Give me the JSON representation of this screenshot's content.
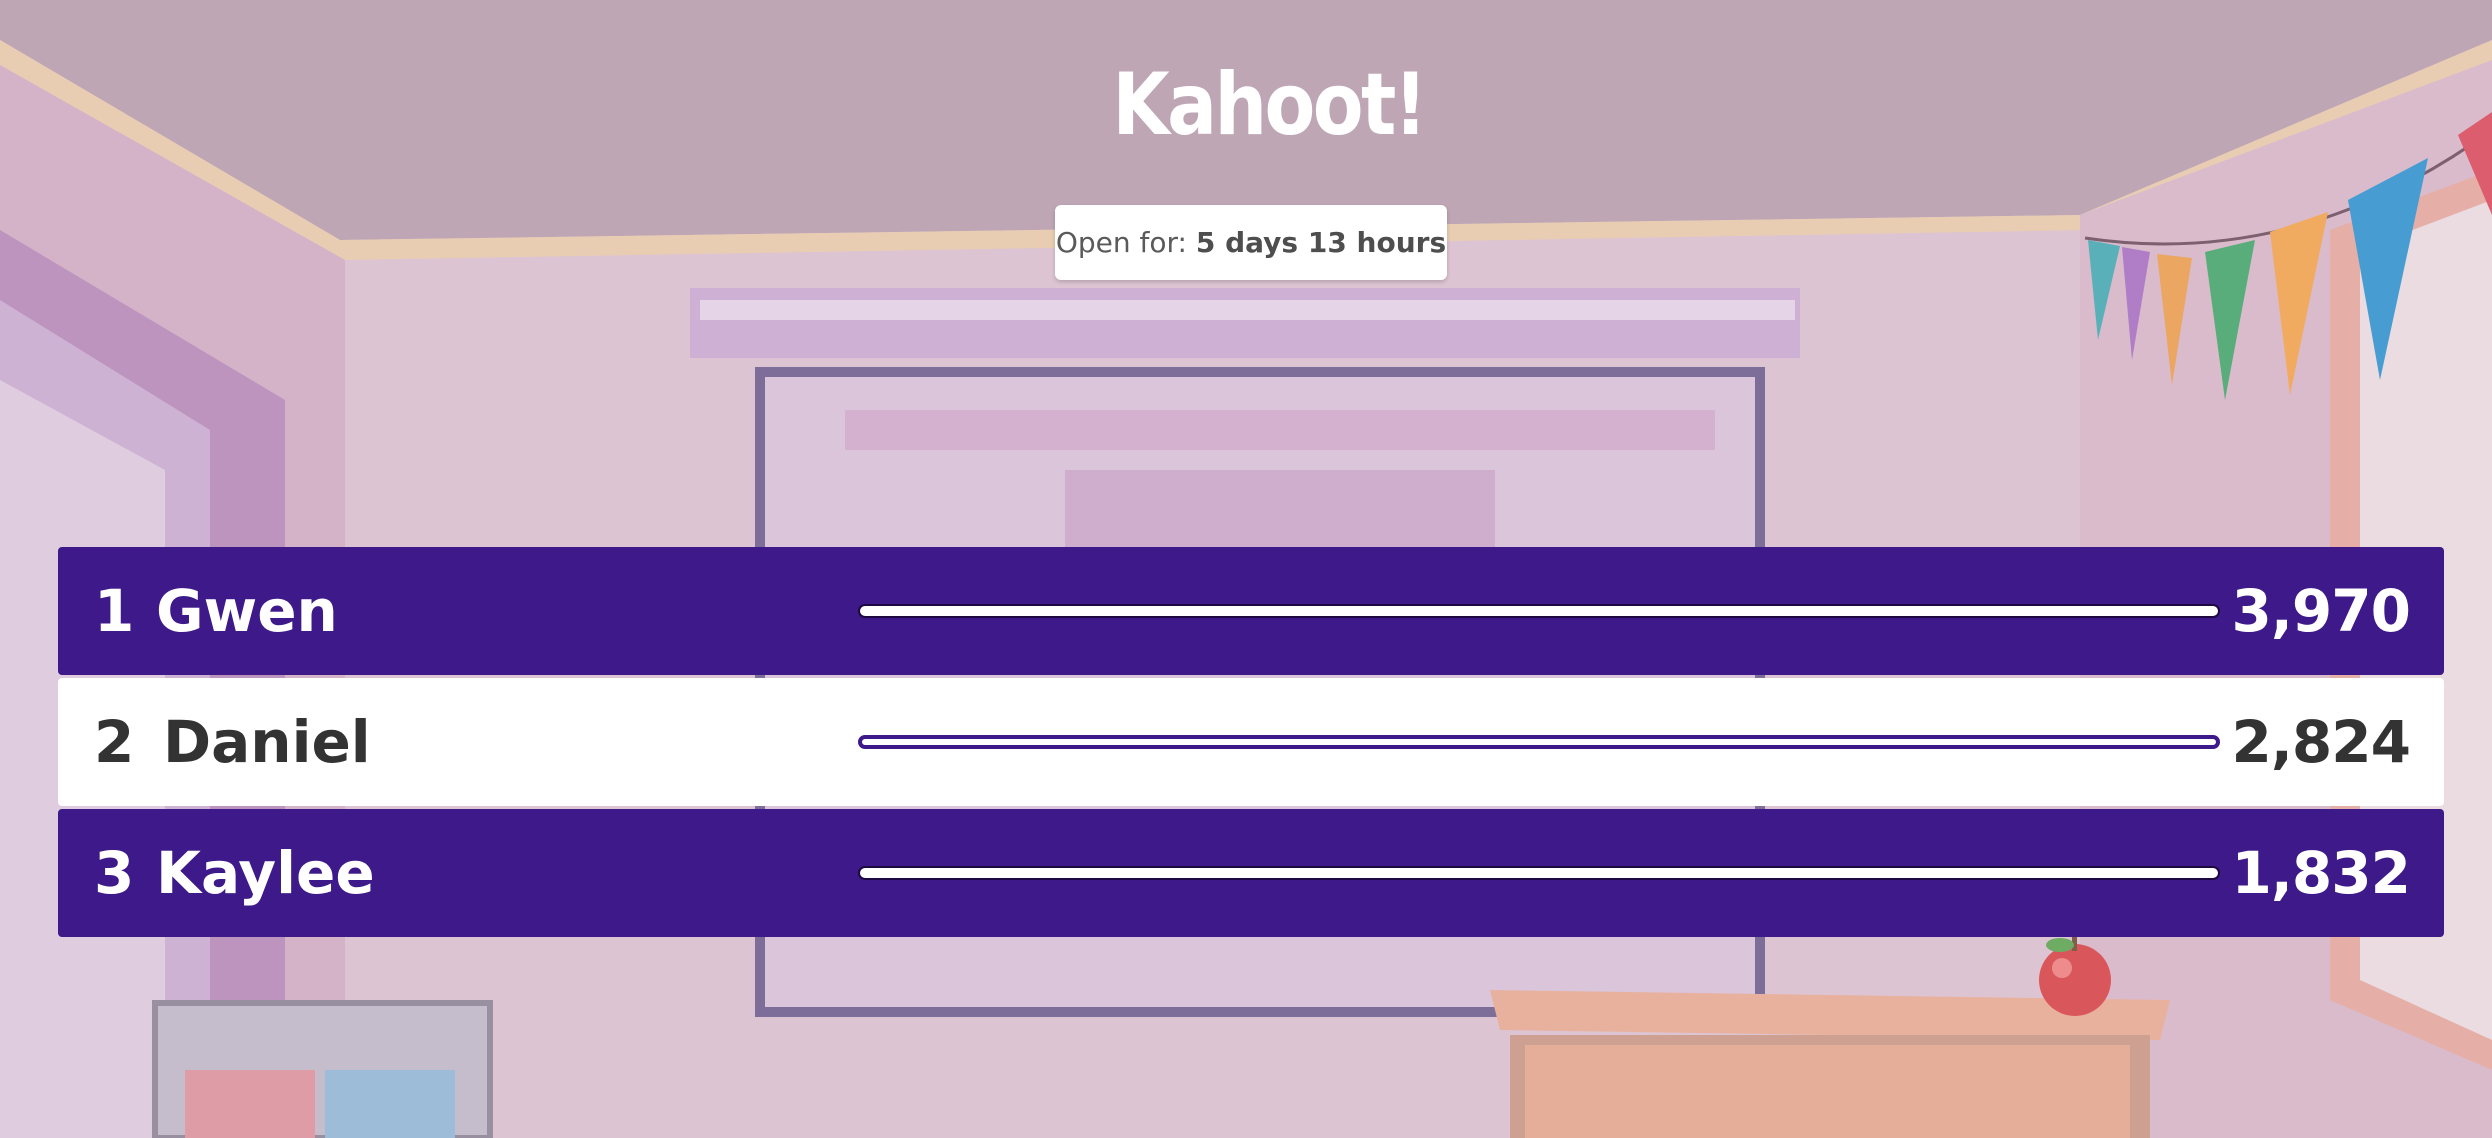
{
  "app": {
    "logo_text": "Kahoot!"
  },
  "timer": {
    "label": "Open for: ",
    "value": "5 days 13 hours"
  },
  "leaderboard": [
    {
      "rank": "1",
      "name": "Gwen",
      "score": "3,970",
      "highlighted": false,
      "progress": 1.0
    },
    {
      "rank": "2",
      "name": "Daniel",
      "score": "2,824",
      "highlighted": true,
      "progress": 1.0
    },
    {
      "rank": "3",
      "name": "Kaylee",
      "score": "1,832",
      "highlighted": false,
      "progress": 1.0
    }
  ],
  "colors": {
    "row_purple": "#3d1989",
    "row_highlight": "#ffffff",
    "background_tint": "#b59aab"
  }
}
